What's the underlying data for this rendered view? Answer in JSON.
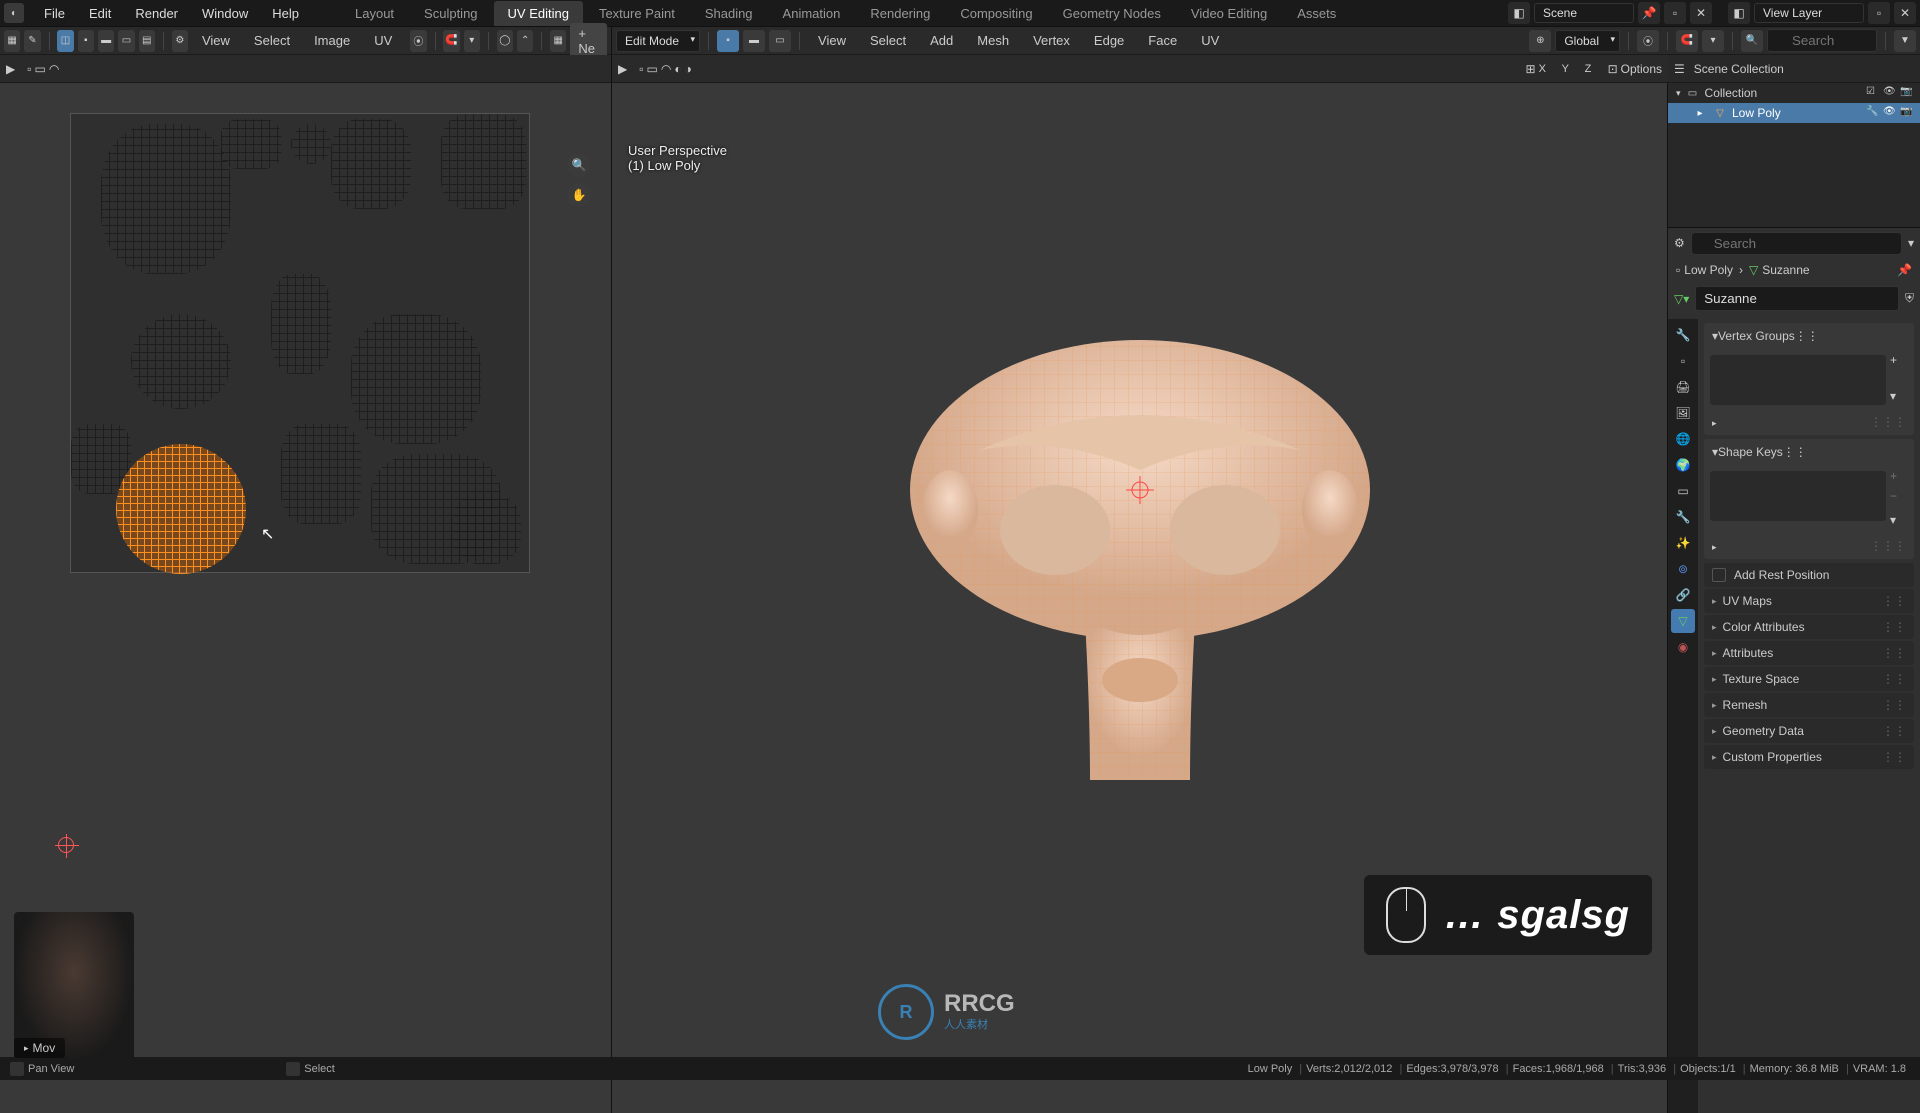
{
  "top_menu": {
    "file": "File",
    "edit": "Edit",
    "render": "Render",
    "window": "Window",
    "help": "Help"
  },
  "workspaces": {
    "layout": "Layout",
    "sculpting": "Sculpting",
    "uv": "UV Editing",
    "texture": "Texture Paint",
    "shading": "Shading",
    "animation": "Animation",
    "rendering": "Rendering",
    "compositing": "Compositing",
    "geometry": "Geometry Nodes",
    "video": "Video Editing",
    "assets": "Assets"
  },
  "scene_label": "Scene",
  "view_layer_label": "View Layer",
  "uv_header": {
    "view": "View",
    "select": "Select",
    "image": "Image",
    "uv": "UV",
    "new_btn": "Ne"
  },
  "vp_header": {
    "mode": "Edit Mode",
    "view": "View",
    "select": "Select",
    "add": "Add",
    "mesh": "Mesh",
    "vertex": "Vertex",
    "edge": "Edge",
    "face": "Face",
    "uv": "UV",
    "orientation": "Global",
    "options": "Options",
    "axis_x": "X",
    "axis_y": "Y",
    "axis_z": "Z"
  },
  "vp_overlay": {
    "persp": "User Perspective",
    "obj": "(1) Low Poly"
  },
  "outliner": {
    "scene_collection": "Scene Collection",
    "collection": "Collection",
    "object": "Low Poly"
  },
  "search_placeholder": "Search",
  "props": {
    "breadcrumb_obj": "Low Poly",
    "breadcrumb_data": "Suzanne",
    "data_name": "Suzanne",
    "vertex_groups": "Vertex Groups",
    "shape_keys": "Shape Keys",
    "add_rest": "Add Rest Position",
    "uv_maps": "UV Maps",
    "color_attrs": "Color Attributes",
    "attributes": "Attributes",
    "texture_space": "Texture Space",
    "remesh": "Remesh",
    "geometry_data": "Geometry Data",
    "custom_props": "Custom Properties"
  },
  "status": {
    "move_hint": "Mov",
    "pan": "Pan View",
    "select": "Select",
    "object_name": "Low Poly",
    "verts": "Verts:2,012/2,012",
    "edges": "Edges:3,978/3,978",
    "faces": "Faces:1,968/1,968",
    "tris": "Tris:3,936",
    "objects": "Objects:1/1",
    "memory": "Memory: 36.8 MiB",
    "vram": "VRAM: 1.8"
  },
  "screencast": "… sgalsg",
  "watermark": {
    "main": "RRCG",
    "sub": "人人素材"
  }
}
